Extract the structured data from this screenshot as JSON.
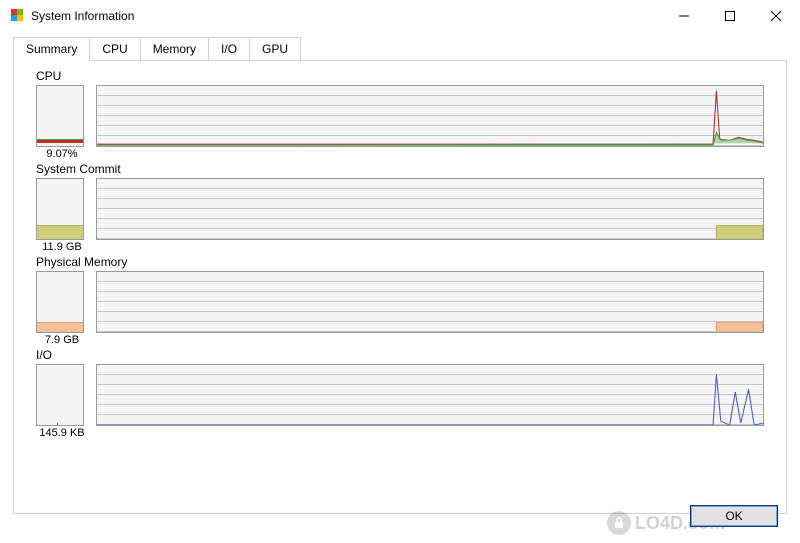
{
  "window": {
    "title": "System Information"
  },
  "tabs": {
    "summary": "Summary",
    "cpu": "CPU",
    "memory": "Memory",
    "io": "I/O",
    "gpu": "GPU"
  },
  "sections": {
    "cpu": {
      "title": "CPU",
      "value": "9.07%"
    },
    "commit": {
      "title": "System Commit",
      "value": "11.9 GB"
    },
    "physmem": {
      "title": "Physical Memory",
      "value": "7.9 GB"
    },
    "io": {
      "title": "I/O",
      "value": "145.9  KB"
    }
  },
  "buttons": {
    "ok": "OK"
  },
  "watermark": "LO4D.com",
  "chart_data": [
    {
      "type": "line",
      "name": "CPU",
      "ylabel": "%",
      "ylim": [
        0,
        100
      ],
      "series": [
        {
          "name": "total",
          "color": "#c03030",
          "values": [
            2,
            2,
            2,
            2,
            2,
            2,
            2,
            2,
            2,
            2,
            2,
            2,
            2,
            2,
            2,
            2,
            2,
            2,
            2,
            2,
            2,
            2,
            2,
            2,
            2,
            2,
            2,
            2,
            2,
            2,
            2,
            2,
            2,
            2,
            2,
            2,
            2,
            2,
            2,
            2,
            2,
            2,
            2,
            2,
            2,
            2,
            2,
            2,
            2,
            2,
            2,
            2,
            2,
            2,
            2,
            2,
            2,
            2,
            2,
            2,
            2,
            2,
            2,
            2,
            2,
            2,
            2,
            2,
            2,
            2,
            2,
            2,
            2,
            2,
            2,
            2,
            2,
            2,
            2,
            2,
            2,
            2,
            2,
            2,
            2,
            2,
            2,
            2,
            2,
            2,
            2,
            2,
            90,
            15,
            12,
            10,
            8,
            9,
            7
          ]
        },
        {
          "name": "kernel",
          "color": "#40a040",
          "values": [
            1,
            1,
            1,
            1,
            1,
            1,
            1,
            1,
            1,
            1,
            1,
            1,
            1,
            1,
            1,
            1,
            1,
            1,
            1,
            1,
            1,
            1,
            1,
            1,
            1,
            1,
            1,
            1,
            1,
            1,
            1,
            1,
            1,
            1,
            1,
            1,
            1,
            1,
            1,
            1,
            1,
            1,
            1,
            1,
            1,
            1,
            1,
            1,
            1,
            1,
            1,
            1,
            1,
            1,
            1,
            1,
            1,
            1,
            1,
            1,
            1,
            1,
            1,
            1,
            1,
            1,
            1,
            1,
            1,
            1,
            1,
            1,
            1,
            1,
            1,
            1,
            1,
            1,
            1,
            1,
            1,
            1,
            1,
            1,
            1,
            1,
            1,
            1,
            1,
            1,
            1,
            1,
            20,
            9,
            8,
            7,
            6,
            7,
            5
          ]
        }
      ]
    },
    {
      "type": "area",
      "name": "System Commit",
      "ylabel": "GB",
      "ylim": [
        0,
        48
      ],
      "color": "#cfce7d",
      "values": [
        0,
        0,
        0,
        0,
        0,
        0,
        0,
        0,
        0,
        0,
        0,
        0,
        0,
        0,
        0,
        0,
        0,
        0,
        0,
        0,
        0,
        0,
        0,
        0,
        0,
        0,
        0,
        0,
        0,
        0,
        0,
        0,
        0,
        0,
        0,
        0,
        0,
        0,
        0,
        0,
        0,
        0,
        0,
        0,
        0,
        0,
        0,
        0,
        0,
        0,
        0,
        0,
        0,
        0,
        0,
        0,
        0,
        0,
        0,
        0,
        0,
        0,
        0,
        0,
        0,
        0,
        0,
        0,
        0,
        0,
        0,
        0,
        0,
        0,
        0,
        0,
        0,
        0,
        0,
        0,
        0,
        0,
        0,
        0,
        0,
        0,
        0,
        0,
        0,
        0,
        0,
        0,
        11.9,
        11.9,
        11.9,
        11.9,
        11.9,
        11.9,
        11.9
      ]
    },
    {
      "type": "area",
      "name": "Physical Memory",
      "ylabel": "GB",
      "ylim": [
        0,
        48
      ],
      "color": "#f4c09a",
      "values": [
        0,
        0,
        0,
        0,
        0,
        0,
        0,
        0,
        0,
        0,
        0,
        0,
        0,
        0,
        0,
        0,
        0,
        0,
        0,
        0,
        0,
        0,
        0,
        0,
        0,
        0,
        0,
        0,
        0,
        0,
        0,
        0,
        0,
        0,
        0,
        0,
        0,
        0,
        0,
        0,
        0,
        0,
        0,
        0,
        0,
        0,
        0,
        0,
        0,
        0,
        0,
        0,
        0,
        0,
        0,
        0,
        0,
        0,
        0,
        0,
        0,
        0,
        0,
        0,
        0,
        0,
        0,
        0,
        0,
        0,
        0,
        0,
        0,
        0,
        0,
        0,
        0,
        0,
        0,
        0,
        0,
        0,
        0,
        0,
        0,
        0,
        0,
        0,
        0,
        0,
        0,
        0,
        7.9,
        7.9,
        7.9,
        7.9,
        7.9,
        7.9,
        7.9
      ]
    },
    {
      "type": "line",
      "name": "I/O",
      "ylabel": "KB/s",
      "ylim": [
        0,
        300
      ],
      "color": "#5060c0",
      "values": [
        0,
        0,
        0,
        0,
        0,
        0,
        0,
        0,
        0,
        0,
        0,
        0,
        0,
        0,
        0,
        0,
        0,
        0,
        0,
        0,
        0,
        0,
        0,
        0,
        0,
        0,
        0,
        0,
        0,
        0,
        0,
        0,
        0,
        0,
        0,
        0,
        0,
        0,
        0,
        0,
        0,
        0,
        0,
        0,
        0,
        0,
        0,
        0,
        0,
        0,
        0,
        0,
        0,
        0,
        0,
        0,
        0,
        0,
        0,
        0,
        0,
        0,
        0,
        0,
        0,
        0,
        0,
        0,
        0,
        0,
        0,
        0,
        0,
        0,
        0,
        0,
        0,
        0,
        0,
        0,
        0,
        0,
        0,
        0,
        0,
        0,
        0,
        0,
        0,
        0,
        0,
        0,
        250,
        20,
        0,
        160,
        10,
        145,
        5
      ]
    }
  ]
}
